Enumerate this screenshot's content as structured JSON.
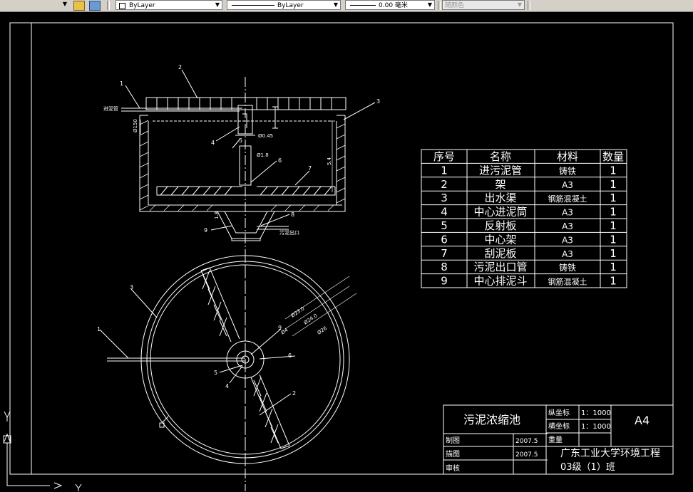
{
  "toolbar": {
    "color_value": "ByLayer",
    "linetype_value": "ByLayer",
    "lineweight_value": "0.00 毫米",
    "plotstyle_value": "随颜色"
  },
  "drawing": {
    "labels": {
      "inlet_pipe": "进泥管",
      "sludge_outlet": "污泥出口",
      "dim_150": "Ø150",
      "dim_0_45": "Ø0.45",
      "dim_1_8": "Ø1.8",
      "dim_5_4": "5.4",
      "dim_1_8v": "1.8",
      "dim_23_0": "Ø23.0",
      "dim_24_0": "Ø24.0",
      "dim_26": "Ø26",
      "dim_4": "Ø4"
    },
    "callouts_section": [
      "1",
      "2",
      "3",
      "4",
      "5",
      "6",
      "7",
      "8",
      "9"
    ],
    "callouts_plan": [
      "1",
      "2",
      "3",
      "4",
      "5",
      "6",
      "9"
    ]
  },
  "parts_table": {
    "headers": [
      "序号",
      "名称",
      "材料",
      "数量"
    ],
    "rows": [
      [
        "1",
        "进污泥管",
        "铸铁",
        "1"
      ],
      [
        "2",
        "架",
        "A3",
        "1"
      ],
      [
        "3",
        "出水渠",
        "钢筋混凝土",
        "1"
      ],
      [
        "4",
        "中心进泥筒",
        "A3",
        "1"
      ],
      [
        "5",
        "反射板",
        "A3",
        "1"
      ],
      [
        "6",
        "中心架",
        "A3",
        "1"
      ],
      [
        "7",
        "刮泥板",
        "A3",
        "1"
      ],
      [
        "8",
        "污泥出口管",
        "铸铁",
        "1"
      ],
      [
        "9",
        "中心排泥斗",
        "钢筋混凝土",
        "1"
      ]
    ]
  },
  "title_block": {
    "title": "污泥浓缩池",
    "vscale_label": "纵坐标",
    "vscale_value": "1：1000",
    "hscale_label": "横坐标",
    "hscale_value": "1：1000",
    "weight_label": "重量",
    "size": "A4",
    "drawn_label": "制图",
    "drawn_date": "2007.5",
    "traced_label": "描图",
    "traced_date": "2007.5",
    "review_label": "审核",
    "school": "广东工业大学环境工程",
    "class_name": "03级（1）班"
  }
}
